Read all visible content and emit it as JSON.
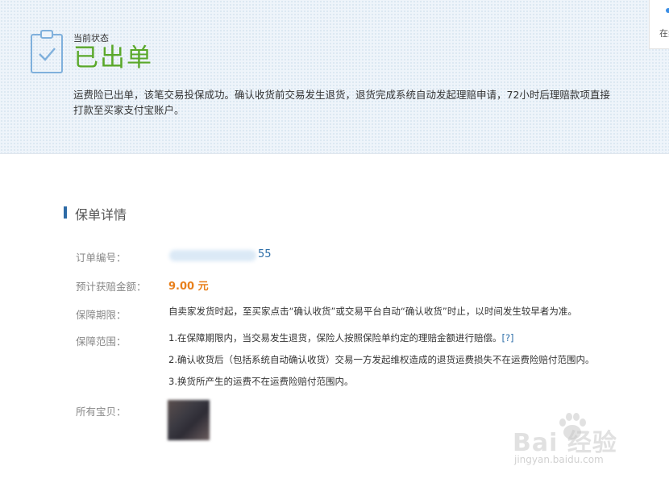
{
  "status": {
    "label": "当前状态",
    "value": "已出单",
    "description": "运费险已出单，该笔交易投保成功。确认收货前交易发生退货，退货完成系统自动发起理赔申请，72小时后理赔款项直接打款至买家支付宝账户。"
  },
  "side_widget": {
    "text": "在线"
  },
  "section": {
    "title": "保单详情"
  },
  "details": {
    "order_label": "订单编号：",
    "order_visible_tail": "55",
    "amount_label": "预计获赔金额：",
    "amount_value": "9.00 元",
    "period_label": "保障期限：",
    "period_value": "自卖家发货时起，至买家点击“确认收货”或交易平台自动“确认收货”时止，以时间发生较早者为准。",
    "scope_label": "保障范围：",
    "scope_items": [
      "1.在保障期限内，当交易发生退货，保险人按照保险单约定的理赔金额进行赔偿。",
      "2.确认收货后（包括系统自动确认收货）交易一方发起维权造成的退货运费损失不在运费险赔付范围内。",
      "3.换货所产生的运费不在运费险赔付范围内。"
    ],
    "scope_help": "[?]",
    "items_label": "所有宝贝："
  },
  "watermark": {
    "text": "Bai 经验",
    "sub": "jingyan.baidu.com"
  },
  "colors": {
    "status_green": "#5aa82a",
    "amount_orange": "#e8801c",
    "link_blue": "#2d6ea8",
    "section_bar": "#2e6ba6"
  }
}
